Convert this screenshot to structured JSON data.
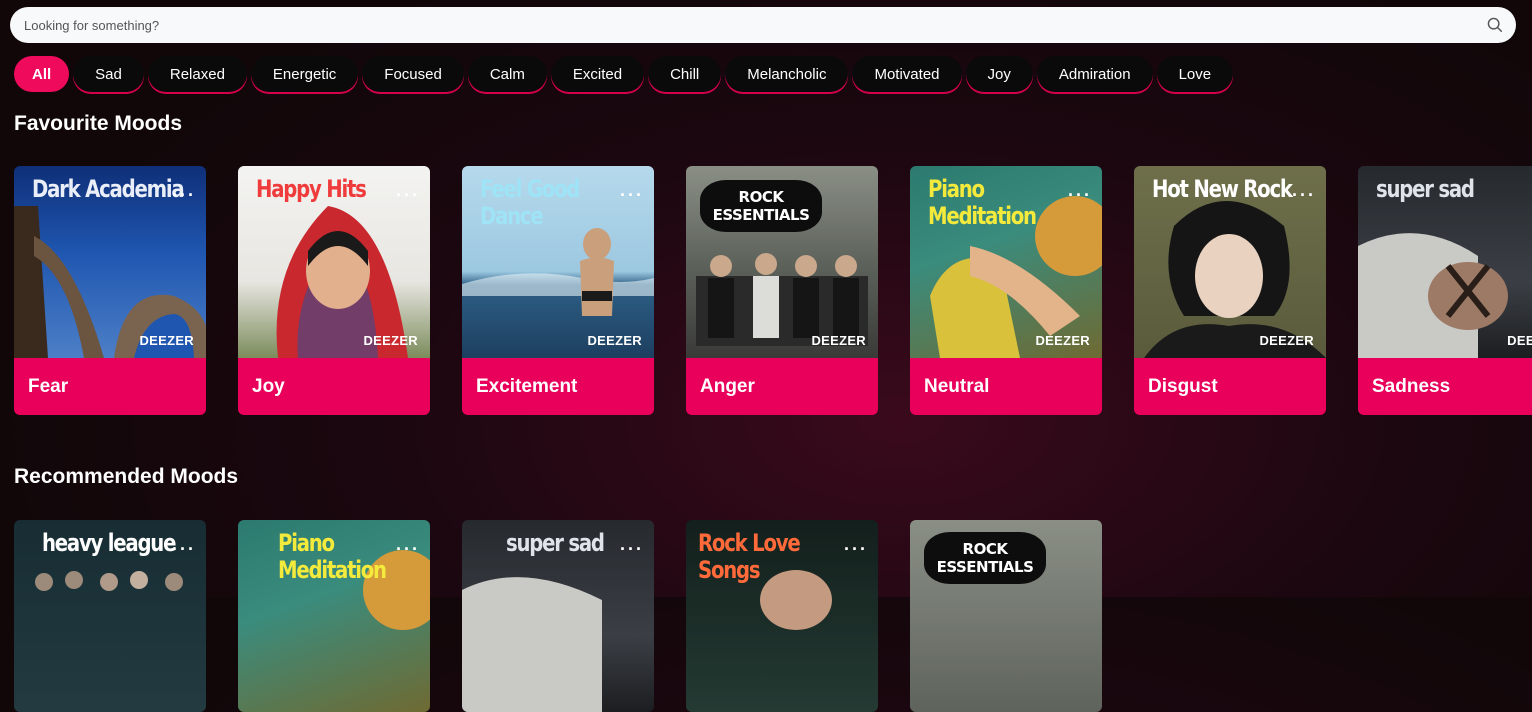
{
  "search": {
    "placeholder": "Looking for something?",
    "icon": "search-icon"
  },
  "moods": [
    "All",
    "Sad",
    "Relaxed",
    "Energetic",
    "Focused",
    "Calm",
    "Excited",
    "Chill",
    "Melancholic",
    "Motivated",
    "Joy",
    "Admiration",
    "Love"
  ],
  "favourite": {
    "title": "Favourite Moods",
    "cards": [
      {
        "cover_title": "Dark Academia",
        "label": "Fear",
        "brand": "DEEZER"
      },
      {
        "cover_title": "Happy Hits",
        "label": "Joy",
        "brand": "DEEZER"
      },
      {
        "cover_title": "Feel Good\nDance",
        "label": "Excitement",
        "brand": "DEEZER"
      },
      {
        "cover_title": "ROCK\nESSENTIALS",
        "label": "Anger",
        "brand": "DEEZER"
      },
      {
        "cover_title": "Piano\nMeditation",
        "label": "Neutral",
        "brand": "DEEZER"
      },
      {
        "cover_title": "Hot New Rock",
        "label": "Disgust",
        "brand": "DEEZER"
      },
      {
        "cover_title": "super sad",
        "label": "Sadness",
        "brand": "DEEZE"
      }
    ]
  },
  "recommended": {
    "title": "Recommended Moods",
    "cards": [
      {
        "cover_title": "heavy league"
      },
      {
        "cover_title": "Piano\nMeditation"
      },
      {
        "cover_title": "super sad"
      },
      {
        "cover_title": "Rock Love\nSongs"
      },
      {
        "cover_title": "ROCK\nESSENTIALS"
      }
    ]
  },
  "colors": {
    "accent": "#e8005a",
    "chip_active": "#ef0a5c"
  },
  "more_glyph": "..."
}
